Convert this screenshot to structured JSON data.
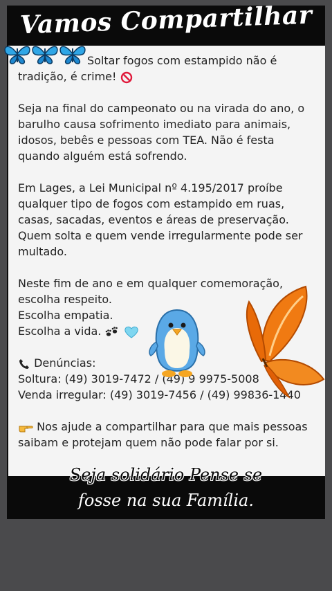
{
  "header": {
    "title": "Vamos Compartilhar"
  },
  "post": {
    "p1_line1": "Soltar fogos com estampido não é",
    "p1_line2": "tradição, é crime!",
    "p2": [
      "Seja na final do campeonato ou na virada do ano, o",
      "barulho causa sofrimento imediato para animais,",
      "idosos, bebês e pessoas com TEA. Não é festa",
      "quando alguém está sofrendo."
    ],
    "p3": [
      "Em Lages, a Lei Municipal nº 4.195/2017 proíbe",
      "qualquer tipo de fogos com estampido em ruas,",
      "casas, sacadas, eventos e áreas de preservação.",
      "Quem solta e quem vende irregularmente pode ser",
      "multado."
    ],
    "p4": [
      "Neste fim de ano e em qualquer comemoração,",
      "escolha respeito.",
      "Escolha empatia.",
      "Escolha a vida."
    ],
    "denuncias_label": "Denúncias:",
    "soltura": "Soltura: (49) 3019-7472 / (49) 9 9975-5008",
    "venda": "Venda irregular: (49) 3019-7456 / (49) 99836-1440",
    "p6_line1": "Nos ajude a compartilhar para que mais pessoas",
    "p6_line2": "saibam e protejam quem não pode falar por si."
  },
  "footer": {
    "line1": "Seja solidário Pense se",
    "line2": "fosse na sua  Família."
  },
  "icons": {
    "butterfly_small": "blue-butterfly-icon",
    "prohibited": "prohibited-icon",
    "paws": "paw-prints-icon",
    "heart": "light-blue-heart-icon",
    "phone": "telephone-icon",
    "pointing": "pointing-hand-icon",
    "penguin": "penguin-sticker",
    "butterfly_big": "orange-butterfly-sticker"
  },
  "colors": {
    "background": "#4a4a4c",
    "frame": "#0a0a0a",
    "card": "#f4f4f4",
    "text": "#222222",
    "butterfly_orange": "#f07a12"
  }
}
